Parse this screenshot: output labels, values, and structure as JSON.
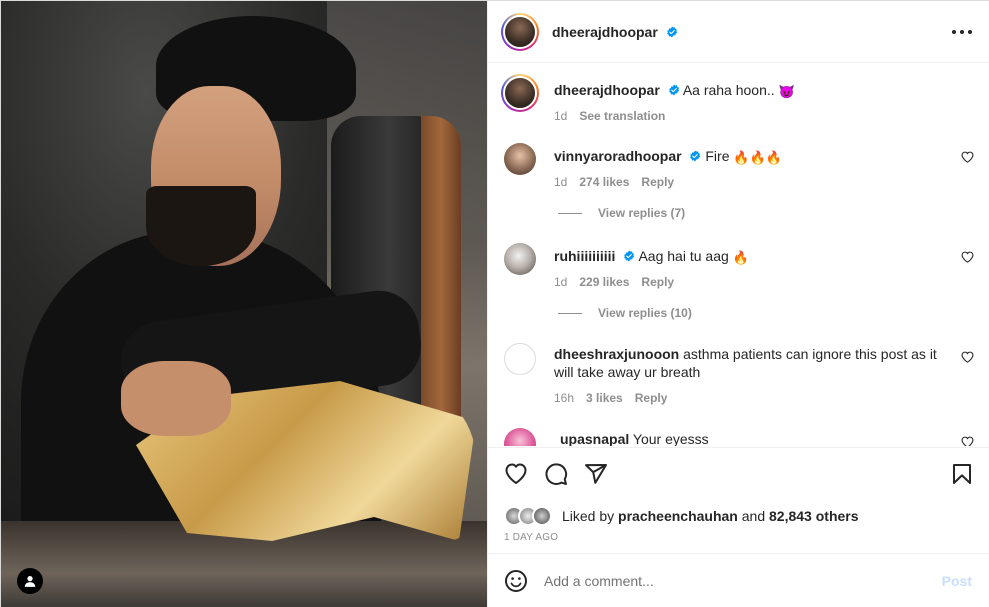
{
  "post": {
    "author": "dheerajdhoopar",
    "caption_user": "dheerajdhoopar",
    "caption": "Aa raha hoon..",
    "caption_emoji": "😈",
    "caption_time": "1d",
    "see_translation": "See translation"
  },
  "comments": [
    {
      "user": "vinnyaroradhoopar",
      "verified": true,
      "text": "Fire",
      "emoji": "🔥🔥🔥",
      "time": "1d",
      "likes": "274 likes",
      "reply": "Reply",
      "view_replies": "View replies (7)"
    },
    {
      "user": "ruhiiiiiiiiii",
      "verified": true,
      "text": "Aag hai tu aag",
      "emoji": "🔥",
      "time": "1d",
      "likes": "229 likes",
      "reply": "Reply",
      "view_replies": "View replies (10)"
    },
    {
      "user": "dheeshraxjunooon",
      "verified": false,
      "text": "asthma patients can ignore this post as it will take away ur breath",
      "time": "16h",
      "likes": "3 likes",
      "reply": "Reply"
    },
    {
      "user": "upasnapal",
      "verified": false,
      "text": "Your eyesss"
    }
  ],
  "likes": {
    "prefix": "Liked by",
    "user": "pracheenchauhan",
    "and": "and",
    "others": "82,843 others"
  },
  "date": "1 DAY AGO",
  "add_comment": {
    "placeholder": "Add a comment...",
    "post_label": "Post"
  },
  "colors": {
    "verified": "#0095f6",
    "muted": "#8e8e8e",
    "post_disabled": "#c7e0fd"
  }
}
